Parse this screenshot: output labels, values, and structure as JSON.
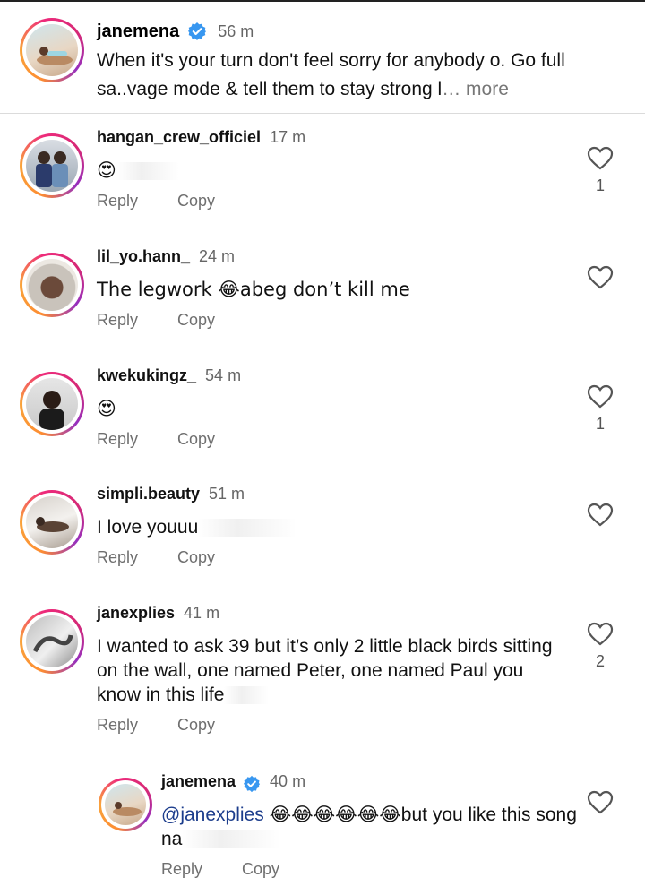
{
  "caption": {
    "username": "janemena",
    "time": "56 m",
    "text": "When it's your turn don't feel sorry for anybody o. Go full sa..vage mode & tell them to stay strong l",
    "more": "… more"
  },
  "actions": {
    "reply": "Reply",
    "copy": "Copy"
  },
  "comments": [
    {
      "username": "hangan_crew_officiel",
      "time": "17 m",
      "text": "😍",
      "likes": "1"
    },
    {
      "username": "lil_yo.hann_",
      "time": "24 m",
      "text": "The legwork 😂abeg don’t kill me",
      "likes": ""
    },
    {
      "username": "kwekukingz_",
      "time": "54 m",
      "text": "😍",
      "likes": "1"
    },
    {
      "username": "simpli.beauty",
      "time": "51 m",
      "text": "I love youuu",
      "likes": ""
    },
    {
      "username": "janexplies",
      "time": "41 m",
      "text": "I wanted to ask 39 but it’s only 2 little black birds sitting on the wall, one named Peter, one named Paul you know in this life",
      "likes": "2"
    }
  ],
  "reply": {
    "username": "janemena",
    "time": "40 m",
    "mention": "@janexplies",
    "emojis": "😂😂😂😂😂😂",
    "text": "but you like this song na"
  },
  "colors": {
    "verified": "#3897f0",
    "mention": "#1c3d8c",
    "ring": "#ee2a7b"
  }
}
